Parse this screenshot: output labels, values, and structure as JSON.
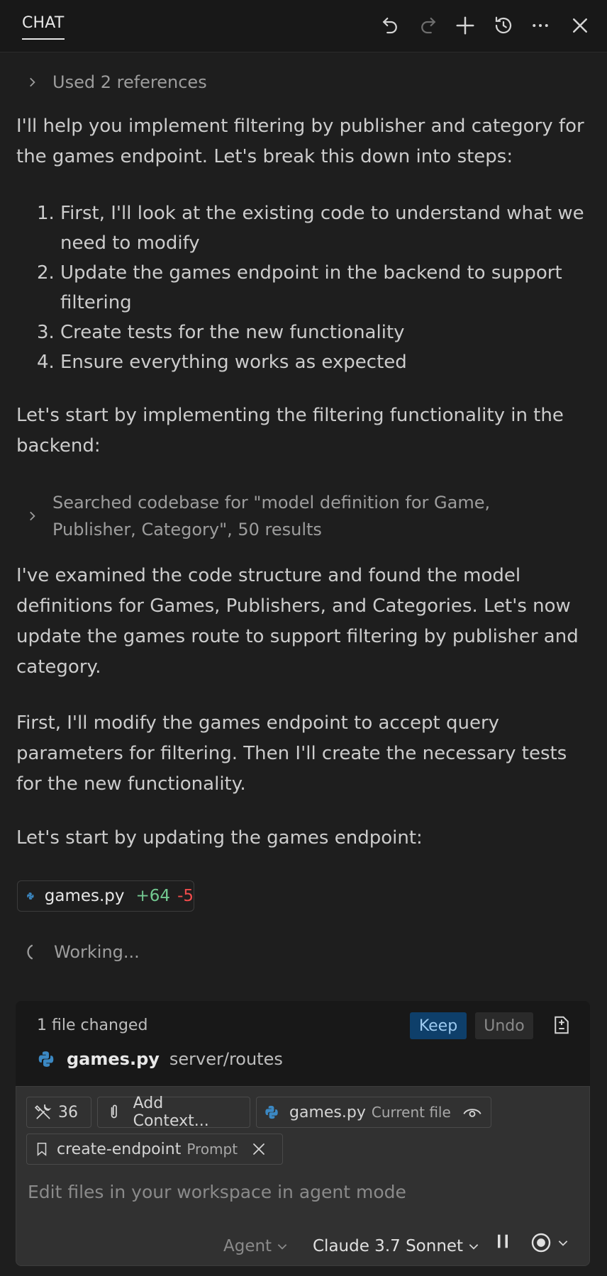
{
  "header": {
    "tab_label": "CHAT",
    "icons": [
      "undo-icon",
      "redo-icon",
      "plus-icon",
      "history-icon",
      "more-icon",
      "close-icon"
    ]
  },
  "transcript": {
    "refs_label": "Used 2 references",
    "intro": "I'll help you implement filtering by publisher and category for the games endpoint. Let's break this down into steps:",
    "steps": [
      {
        "num": "1.",
        "text": "First, I'll look at the existing code to understand what we need to modify"
      },
      {
        "num": "2.",
        "text": "Update the games endpoint in the backend to support filtering"
      },
      {
        "num": "3.",
        "text": "Create tests for the new functionality"
      },
      {
        "num": "4.",
        "text": "Ensure everything works as expected"
      }
    ],
    "start_text": "Let's start by implementing the filtering functionality in the backend:",
    "search_label": "Searched codebase for \"model definition for Game, Publisher, Category\", 50 results",
    "examined_text": "I've examined the code structure and found the model definitions for Games, Publishers, and Categories. Let's now update the games route to support filtering by publisher and category.",
    "first_text": "First, I'll modify the games endpoint to accept query parameters for filtering. Then I'll create the necessary tests for the new functionality.",
    "update_text": "Let's start by updating the games endpoint:",
    "file_chip": {
      "name": "games.py",
      "added": "+64",
      "removed": "-5"
    },
    "working_label": "Working..."
  },
  "changes": {
    "count_label": "1 file changed",
    "keep_label": "Keep",
    "undo_label": "Undo",
    "file_name": "games.py",
    "file_path": "server/routes"
  },
  "input": {
    "tools_count": "36",
    "add_context_label": "Add Context...",
    "current_file_name": "games.py",
    "current_file_tag": "Current file",
    "prompt_name": "create-endpoint",
    "prompt_tag": "Prompt",
    "placeholder": "Edit files in your workspace in agent mode",
    "mode_label": "Agent",
    "model_label": "Claude 3.7 Sonnet"
  },
  "colors": {
    "background": "#1e1e1e",
    "added": "#73c991",
    "removed": "#f14c4c",
    "keep_button": "#0e3f6a"
  }
}
